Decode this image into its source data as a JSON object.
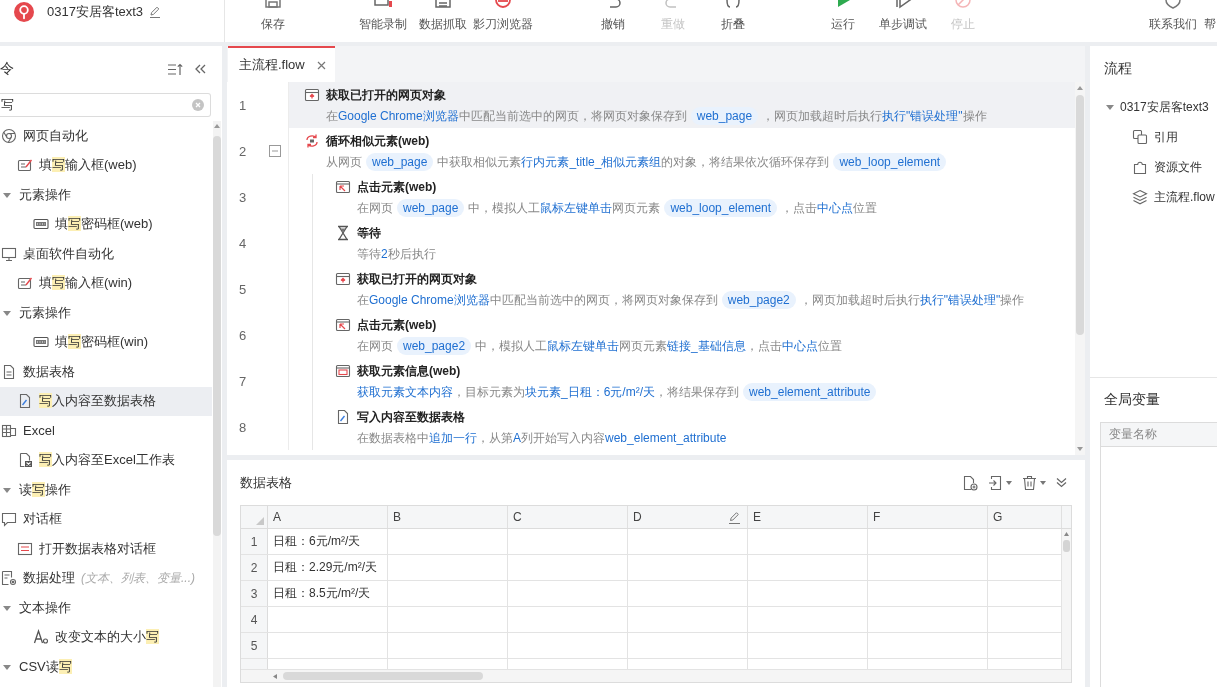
{
  "app": {
    "title": "0317安居客text3"
  },
  "toolbar_groups": [
    {
      "buttons": [
        {
          "label": "保存",
          "disabled": false
        }
      ]
    },
    {
      "buttons": [
        {
          "label": "智能录制",
          "disabled": false
        },
        {
          "label": "数据抓取",
          "disabled": false
        },
        {
          "label": "影刀浏览器",
          "disabled": false
        }
      ]
    },
    {
      "buttons": [
        {
          "label": "撤销",
          "disabled": false
        },
        {
          "label": "重做",
          "disabled": true
        },
        {
          "label": "折叠",
          "disabled": false
        }
      ]
    },
    {
      "buttons": [
        {
          "label": "运行",
          "disabled": false
        },
        {
          "label": "单步调试",
          "disabled": false
        },
        {
          "label": "停止",
          "disabled": true
        }
      ]
    },
    {
      "buttons": [
        {
          "label": "联系我们",
          "disabled": false
        },
        {
          "label": "帮",
          "disabled": false
        }
      ]
    }
  ],
  "commands_panel": {
    "title": "令",
    "search": {
      "value": "写"
    },
    "tree": [
      {
        "kind": "category",
        "label": "网页自动化",
        "selected": false,
        "children": [
          {
            "kind": "command",
            "label_pre": "填",
            "label_match": "写",
            "label_post": "输入框(web)",
            "selected": false
          },
          {
            "kind": "group",
            "label": "元素操作",
            "expanded": true,
            "selected": false,
            "children": [
              {
                "kind": "command",
                "label_pre": "填",
                "label_match": "写",
                "label_post": "密码框(web)",
                "selected": false
              }
            ]
          }
        ]
      },
      {
        "kind": "category",
        "label": "桌面软件自动化",
        "selected": false,
        "children": [
          {
            "kind": "command",
            "label_pre": "填",
            "label_match": "写",
            "label_post": "输入框(win)",
            "selected": false
          },
          {
            "kind": "group",
            "label": "元素操作",
            "expanded": true,
            "selected": false,
            "children": [
              {
                "kind": "command",
                "label_pre": "填",
                "label_match": "写",
                "label_post": "密码框(win)",
                "selected": false
              }
            ]
          }
        ]
      },
      {
        "kind": "category",
        "label": "数据表格",
        "selected": false,
        "children": [
          {
            "kind": "command",
            "label_match": "写",
            "label_post": "入内容至数据表格",
            "selected": true
          }
        ]
      },
      {
        "kind": "category",
        "label": "Excel",
        "selected": false,
        "children": [
          {
            "kind": "command",
            "label_match": "写",
            "label_post": "入内容至Excel工作表",
            "selected": false
          },
          {
            "kind": "group",
            "label_pre": "读",
            "label_match": "写",
            "label_post": "操作",
            "expanded": true,
            "selected": false
          }
        ]
      },
      {
        "kind": "category",
        "label": "对话框",
        "selected": false,
        "children": [
          {
            "kind": "command",
            "label": "打开数据表格对话框",
            "selected": false
          }
        ]
      },
      {
        "kind": "category",
        "label": "数据处理",
        "hint": "(文本、列表、变量...)",
        "selected": false,
        "children": [
          {
            "kind": "group",
            "label": "文本操作",
            "expanded": true,
            "selected": false,
            "children": [
              {
                "kind": "command",
                "label_pre": "改变文本的大小",
                "label_match": "写",
                "selected": false
              }
            ]
          },
          {
            "kind": "group",
            "label_pre": "CSV读",
            "label_match": "写",
            "expanded": true,
            "selected": false
          }
        ]
      }
    ]
  },
  "editor": {
    "tabs": [
      {
        "label": "主流程.flow",
        "selected": true
      }
    ],
    "steps": [
      {
        "line": "1",
        "title": "获取已打开的网页对象",
        "selected": true,
        "desc": [
          {
            "kind": "text",
            "text": "在"
          },
          {
            "kind": "link",
            "text": "Google Chrome浏览器"
          },
          {
            "kind": "text",
            "text": "中匹配当前选中的网页，将网页对象保存到"
          },
          {
            "kind": "var",
            "text": "web_page"
          },
          {
            "kind": "text",
            "text": "，网页加载超时后执行"
          },
          {
            "kind": "link",
            "text": "执行\"错误处理\""
          },
          {
            "kind": "text",
            "text": "操作"
          }
        ]
      },
      {
        "line": "2",
        "title": "循环相似元素(web)",
        "selected": false,
        "expanded": true,
        "desc": [
          {
            "kind": "text",
            "text": "从网页"
          },
          {
            "kind": "var",
            "text": "web_page"
          },
          {
            "kind": "text",
            "text": "中获取相似元素"
          },
          {
            "kind": "link",
            "text": "行内元素_title_相似元素组"
          },
          {
            "kind": "text",
            "text": "的对象，将结果依次循环保存到"
          },
          {
            "kind": "var",
            "text": "web_loop_element"
          }
        ],
        "children": [
          {
            "line": "3",
            "title": "点击元素(web)",
            "selected": false,
            "desc": [
              {
                "kind": "text",
                "text": "在网页"
              },
              {
                "kind": "var",
                "text": "web_page"
              },
              {
                "kind": "text",
                "text": "中，模拟人工"
              },
              {
                "kind": "link",
                "text": "鼠标左键单击"
              },
              {
                "kind": "text",
                "text": "网页元素"
              },
              {
                "kind": "var",
                "text": "web_loop_element"
              },
              {
                "kind": "text",
                "text": "，点击"
              },
              {
                "kind": "link",
                "text": "中心点"
              },
              {
                "kind": "text",
                "text": "位置"
              }
            ]
          },
          {
            "line": "4",
            "title": "等待",
            "selected": false,
            "desc": [
              {
                "kind": "text",
                "text": "等待"
              },
              {
                "kind": "link",
                "text": "2"
              },
              {
                "kind": "text",
                "text": "秒后执行"
              }
            ]
          },
          {
            "line": "5",
            "title": "获取已打开的网页对象",
            "selected": false,
            "desc": [
              {
                "kind": "text",
                "text": "在"
              },
              {
                "kind": "link",
                "text": "Google Chrome浏览器"
              },
              {
                "kind": "text",
                "text": "中匹配当前选中的网页，将网页对象保存到"
              },
              {
                "kind": "var",
                "text": "web_page2"
              },
              {
                "kind": "text",
                "text": "，网页加载超时后执行"
              },
              {
                "kind": "link",
                "text": "执行\"错误处理\""
              },
              {
                "kind": "text",
                "text": "操作"
              }
            ]
          },
          {
            "line": "6",
            "title": "点击元素(web)",
            "selected": false,
            "desc": [
              {
                "kind": "text",
                "text": "在网页"
              },
              {
                "kind": "var",
                "text": "web_page2"
              },
              {
                "kind": "text",
                "text": "中，模拟人工"
              },
              {
                "kind": "link",
                "text": "鼠标左键单击"
              },
              {
                "kind": "text",
                "text": "网页元素"
              },
              {
                "kind": "link",
                "text": "链接_基础信息"
              },
              {
                "kind": "text",
                "text": "，点击"
              },
              {
                "kind": "link",
                "text": "中心点"
              },
              {
                "kind": "text",
                "text": "位置"
              }
            ]
          },
          {
            "line": "7",
            "title": "获取元素信息(web)",
            "selected": false,
            "desc": [
              {
                "kind": "link",
                "text": "获取元素文本内容"
              },
              {
                "kind": "text",
                "text": "，目标元素为"
              },
              {
                "kind": "link",
                "text": "块元素_日租：6元/m²/天"
              },
              {
                "kind": "text",
                "text": "，将结果保存到"
              },
              {
                "kind": "var",
                "text": "web_element_attribute"
              }
            ]
          },
          {
            "line": "8",
            "title": "写入内容至数据表格",
            "selected": false,
            "desc": [
              {
                "kind": "text",
                "text": "在数据表格中"
              },
              {
                "kind": "link",
                "text": "追加一行"
              },
              {
                "kind": "text",
                "text": "，从第"
              },
              {
                "kind": "link",
                "text": "A"
              },
              {
                "kind": "text",
                "text": "列开始写入内容"
              },
              {
                "kind": "link",
                "text": "web_element_attribute"
              }
            ]
          }
        ]
      }
    ]
  },
  "data_table": {
    "title": "数据表格",
    "columns": [
      {
        "label": "A",
        "hovered": false
      },
      {
        "label": "B",
        "hovered": false
      },
      {
        "label": "C",
        "hovered": false
      },
      {
        "label": "D",
        "hovered": true
      },
      {
        "label": "E",
        "hovered": false
      },
      {
        "label": "F",
        "hovered": false
      },
      {
        "label": "G",
        "hovered": false
      }
    ],
    "rows": [
      {
        "label": "1",
        "cells": [
          "日租：6元/m²/天"
        ]
      },
      {
        "label": "2",
        "cells": [
          "日租：2.29元/m²/天"
        ]
      },
      {
        "label": "3",
        "cells": [
          "日租：8.5元/m²/天"
        ]
      },
      {
        "label": "4"
      },
      {
        "label": "5"
      }
    ]
  },
  "process_panel": {
    "title": "流程",
    "tree": [
      {
        "label": "0317安居客text3",
        "expanded": true,
        "children": [
          {
            "label": "引用"
          },
          {
            "label": "资源文件"
          },
          {
            "label": "主流程.flow"
          }
        ]
      }
    ]
  },
  "globals_panel": {
    "title": "全局变量",
    "columns": [
      "变量名称"
    ]
  }
}
